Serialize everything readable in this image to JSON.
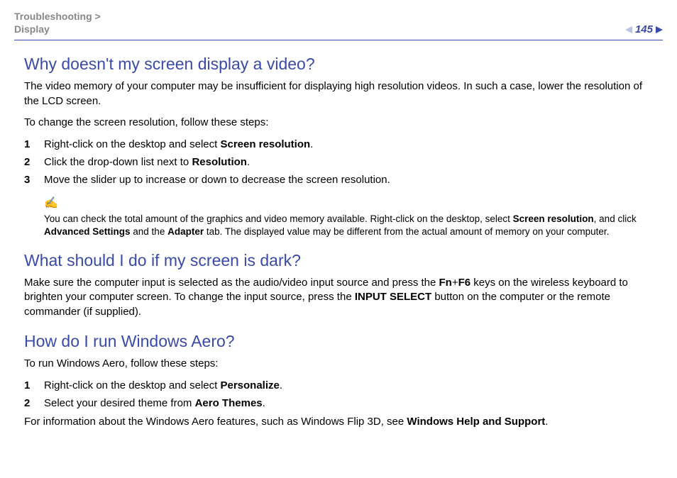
{
  "breadcrumb": {
    "top": "Troubleshooting >",
    "sub": "Display"
  },
  "page_number": "145",
  "sections": [
    {
      "heading": "Why doesn't my screen display a video?",
      "paras": [
        "The video memory of your computer may be insufficient for displaying high resolution videos. In such a case, lower the resolution of the LCD screen.",
        "To change the screen resolution, follow these steps:"
      ],
      "steps": [
        {
          "n": "1",
          "pre": "Right-click on the desktop and select ",
          "b": "Screen resolution",
          "post": "."
        },
        {
          "n": "2",
          "pre": "Click the drop-down list next to ",
          "b": "Resolution",
          "post": "."
        },
        {
          "n": "3",
          "pre": "Move the slider up to increase or down to decrease the screen resolution.",
          "b": "",
          "post": ""
        }
      ],
      "note": {
        "t1": "You can check the total amount of the graphics and video memory available. Right-click on the desktop, select ",
        "b1": "Screen resolution",
        "t2": ", and click ",
        "b2": "Advanced Settings",
        "t3": " and the ",
        "b3": "Adapter",
        "t4": " tab. The displayed value may be different from the actual amount of memory on your computer."
      }
    },
    {
      "heading": "What should I do if my screen is dark?",
      "dark": {
        "t1": "Make sure the computer input is selected as the audio/video input source and press the ",
        "b1": "Fn",
        "t2": "+",
        "b2": "F6",
        "t3": " keys on the wireless keyboard to brighten your computer screen. To change the input source, press the ",
        "b3": "INPUT SELECT",
        "t4": " button on the computer or the remote commander (if supplied)."
      }
    },
    {
      "heading": "How do I run Windows Aero?",
      "intro": "To run Windows Aero, follow these steps:",
      "steps": [
        {
          "n": "1",
          "pre": "Right-click on the desktop and select ",
          "b": "Personalize",
          "post": "."
        },
        {
          "n": "2",
          "pre": "Select your desired theme from ",
          "b": "Aero Themes",
          "post": "."
        }
      ],
      "outro": {
        "t1": "For information about the Windows Aero features, such as Windows Flip 3D, see ",
        "b1": "Windows Help and Support",
        "t2": "."
      }
    }
  ]
}
